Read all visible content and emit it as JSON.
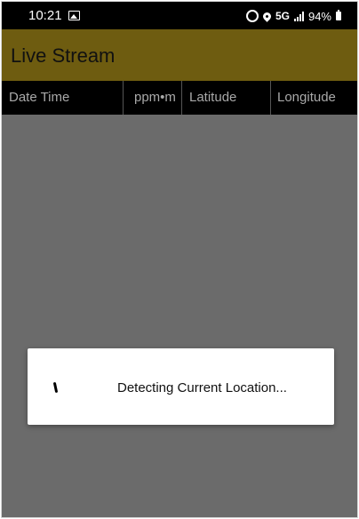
{
  "status_bar": {
    "time": "10:21",
    "network": "5G",
    "battery": "94%",
    "icons": [
      "gallery-icon",
      "alarm-icon",
      "location-icon",
      "signal-icon",
      "battery-icon"
    ]
  },
  "app_bar": {
    "title": "Live Stream",
    "color": "#6e5c10"
  },
  "table": {
    "columns": [
      "Date Time",
      "ppm•m",
      "Latitude",
      "Longitude"
    ],
    "rows": []
  },
  "dialog": {
    "message": "Detecting Current Location...",
    "icon": "loading-spinner-icon"
  },
  "colors": {
    "overlay": "#6b6b6b",
    "header_bg": "#000000",
    "header_text": "#a9a9a9"
  }
}
